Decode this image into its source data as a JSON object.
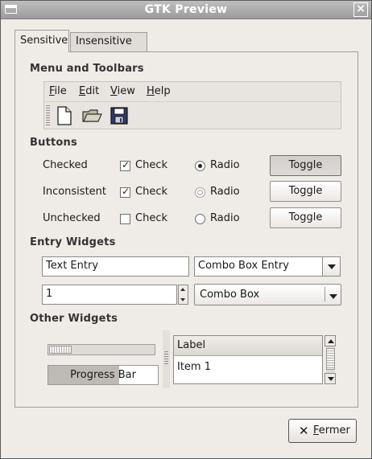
{
  "window": {
    "title": "GTK Preview",
    "close_glyph": "×"
  },
  "tabs": [
    {
      "label": "Sensitive"
    },
    {
      "label": "Insensitive"
    }
  ],
  "sections": {
    "menus": "Menu and Toolbars",
    "buttons": "Buttons",
    "entries": "Entry Widgets",
    "other": "Other Widgets"
  },
  "menubar": [
    {
      "label": "File"
    },
    {
      "label": "Edit"
    },
    {
      "label": "View"
    },
    {
      "label": "Help"
    }
  ],
  "toolbar": {
    "icons": [
      "new-document-icon",
      "open-folder-icon",
      "save-floppy-icon"
    ]
  },
  "button_rows": [
    {
      "label": "Checked",
      "check": "Check",
      "radio": "Radio",
      "toggle": "Toggle",
      "state": "checked"
    },
    {
      "label": "Inconsistent",
      "check": "Check",
      "radio": "Radio",
      "toggle": "Toggle",
      "state": "inconsistent"
    },
    {
      "label": "Unchecked",
      "check": "Check",
      "radio": "Radio",
      "toggle": "Toggle",
      "state": "unchecked"
    }
  ],
  "entries": {
    "text_entry": "Text Entry",
    "combo_entry": "Combo Box Entry",
    "spin_value": "1",
    "combo_box": "Combo Box"
  },
  "other": {
    "progress_label": "Progress Bar",
    "progress": 0.65,
    "scale_value": 0.0,
    "tree_header": "Label",
    "tree_items": [
      "Item 1"
    ]
  },
  "dialog": {
    "close_label": "Fermer"
  },
  "colors": {
    "title_bar": "#a8a8a8",
    "window_bg": "#efebe7"
  }
}
